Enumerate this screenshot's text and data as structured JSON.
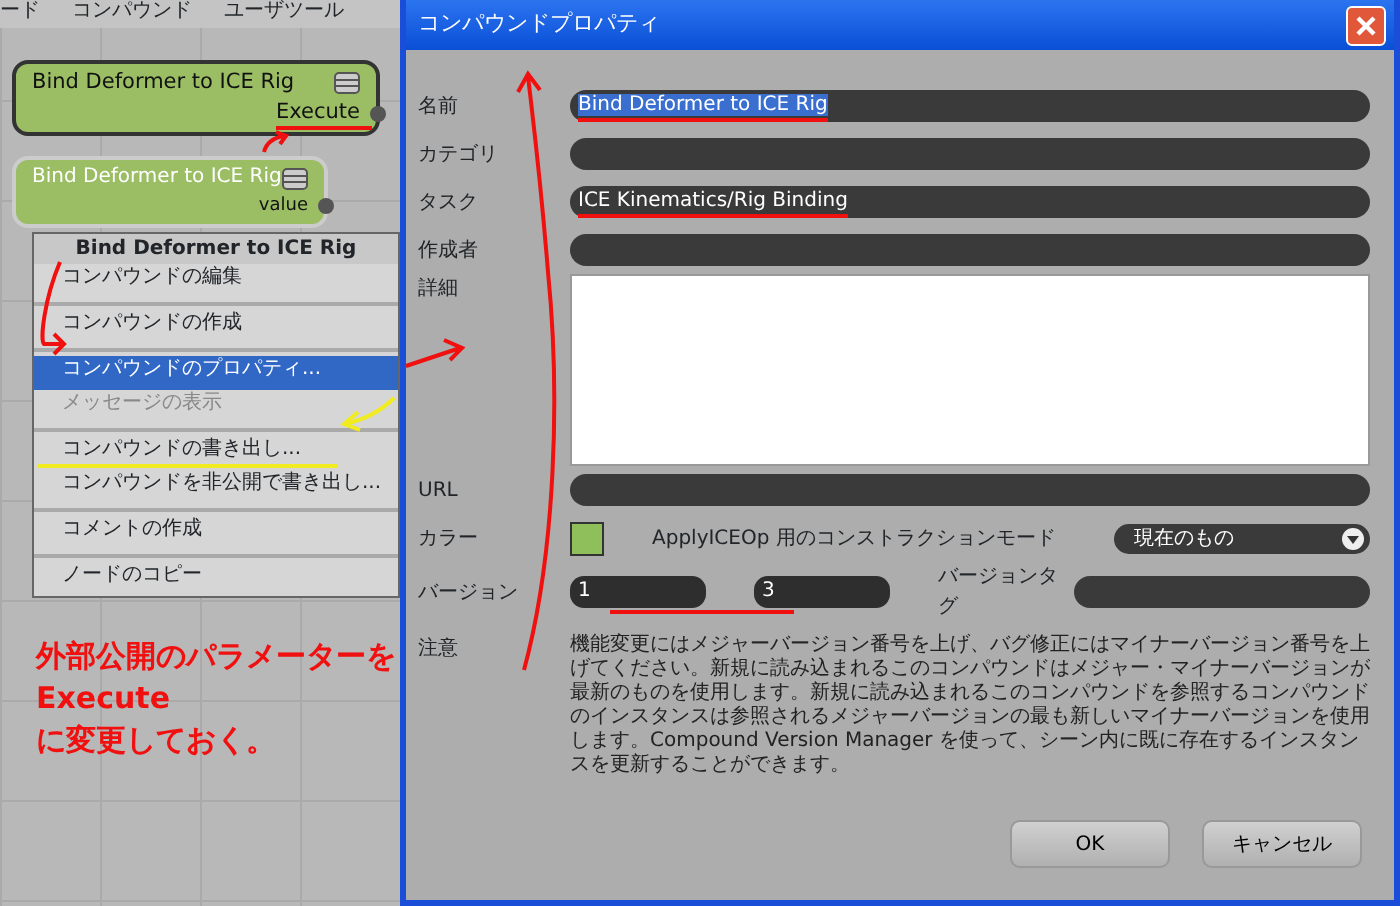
{
  "graph_menu": [
    "ード",
    "コンパウンド",
    "ユーザツール"
  ],
  "nodes": [
    {
      "title": "Bind Deformer to ICE Rig",
      "port": "Execute",
      "selected": true
    },
    {
      "title": "Bind Deformer to ICE Rig",
      "port": "value",
      "selected": false
    }
  ],
  "context_menu": {
    "header": "Bind Deformer to ICE Rig",
    "groups": [
      [
        {
          "label": "コンパウンドの編集",
          "selected": false,
          "disabled": false
        }
      ],
      [
        {
          "label": "コンパウンドの作成",
          "selected": false,
          "disabled": false
        }
      ],
      [
        {
          "label": "コンパウンドのプロパティ...",
          "selected": true,
          "disabled": false
        },
        {
          "label": "メッセージの表示",
          "selected": false,
          "disabled": true
        }
      ],
      [
        {
          "label": "コンパウンドの書き出し...",
          "selected": false,
          "disabled": false
        },
        {
          "label": "コンパウンドを非公開で書き出し...",
          "selected": false,
          "disabled": false
        }
      ],
      [
        {
          "label": "コメントの作成",
          "selected": false,
          "disabled": false
        }
      ],
      [
        {
          "label": "ノードのコピー",
          "selected": false,
          "disabled": false
        }
      ]
    ]
  },
  "annotation": [
    "外部公開のパラメーターを",
    "Execute",
    "に変更しておく。"
  ],
  "dialog": {
    "title": "コンパウンドプロパティ",
    "fields": [
      {
        "kind": "text",
        "label": "名前",
        "value": "Bind Deformer to ICE Rig",
        "text_selected": true
      },
      {
        "kind": "text",
        "label": "カテゴリ"
      },
      {
        "kind": "text",
        "label": "タスク",
        "value": "ICE Kinematics/Rig Binding",
        "text_selected": false
      },
      {
        "kind": "text",
        "label": "作成者"
      },
      {
        "kind": "area",
        "label": "詳細"
      },
      {
        "kind": "text",
        "label": "URL"
      },
      {
        "kind": "color",
        "label": "カラー",
        "color": "#8fbf5a",
        "mode_label": "ApplyICEOp 用のコンストラクションモード",
        "mode_value": "現在のもの"
      },
      {
        "kind": "version",
        "label": "バージョン",
        "major": "1",
        "minor": "3",
        "tag_label": "バージョンタグ"
      },
      {
        "kind": "note",
        "label": "注意",
        "text": "機能変更にはメジャーバージョン番号を上げ、バグ修正にはマイナーバージョン番号を上げてください。新規に読み込まれるこのコンパウンドはメジャー・マイナーバージョンが最新のものを使用します。新規に読み込まれるこのコンパウンドを参照するコンパウンドのインスタンスは参照されるメジャーバージョンの最も新しいマイナーバージョンを使用します。Compound Version Manager を使って、シーン内に既に存在するインスタンスを更新することができます。"
      }
    ],
    "buttons": [
      "OK",
      "キャンセル"
    ]
  }
}
